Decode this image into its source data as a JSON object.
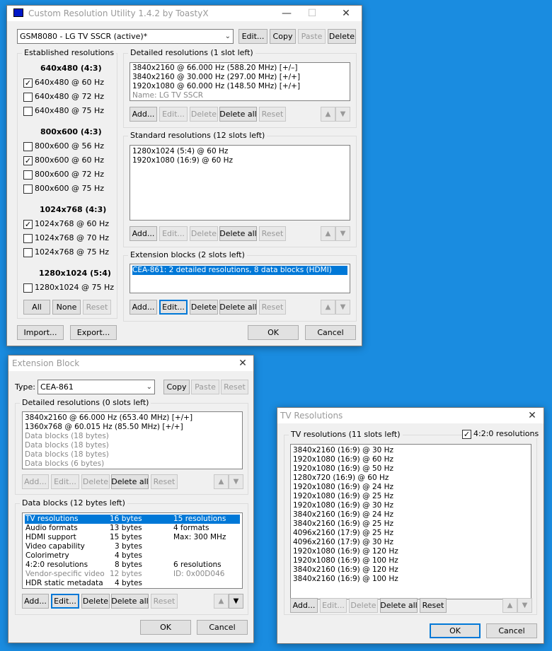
{
  "main": {
    "title": "Custom Resolution Utility 1.4.2 by ToastyX",
    "monitor": "GSM8080 - LG TV SSCR (active)*",
    "top_buttons": {
      "edit": "Edit...",
      "copy": "Copy",
      "paste": "Paste",
      "delete": "Delete"
    },
    "established": {
      "label": "Established resolutions",
      "groups": [
        {
          "header": "640x480 (4:3)",
          "items": [
            {
              "label": "640x480 @ 60 Hz",
              "checked": true
            },
            {
              "label": "640x480 @ 72 Hz",
              "checked": false
            },
            {
              "label": "640x480 @ 75 Hz",
              "checked": false
            }
          ]
        },
        {
          "header": "800x600 (4:3)",
          "items": [
            {
              "label": "800x600 @ 56 Hz",
              "checked": false
            },
            {
              "label": "800x600 @ 60 Hz",
              "checked": true
            },
            {
              "label": "800x600 @ 72 Hz",
              "checked": false
            },
            {
              "label": "800x600 @ 75 Hz",
              "checked": false
            }
          ]
        },
        {
          "header": "1024x768 (4:3)",
          "items": [
            {
              "label": "1024x768 @ 60 Hz",
              "checked": true
            },
            {
              "label": "1024x768 @ 70 Hz",
              "checked": false
            },
            {
              "label": "1024x768 @ 75 Hz",
              "checked": false
            }
          ]
        },
        {
          "header": "1280x1024 (5:4)",
          "items": [
            {
              "label": "1280x1024 @ 75 Hz",
              "checked": false
            }
          ]
        }
      ],
      "buttons": {
        "all": "All",
        "none": "None",
        "reset": "Reset"
      }
    },
    "detailed": {
      "label": "Detailed resolutions (1 slot left)",
      "items": [
        "3840x2160 @ 66.000 Hz (588.20 MHz) [+/–]",
        "3840x2160 @ 30.000 Hz (297.00 MHz) [+/+]",
        "1920x1080 @ 60.000 Hz (148.50 MHz) [+/+]",
        "Name: LG TV SSCR"
      ]
    },
    "standard": {
      "label": "Standard resolutions (12 slots left)",
      "items": [
        "1280x1024 (5:4) @ 60 Hz",
        "1920x1080 (16:9) @ 60 Hz"
      ]
    },
    "extension": {
      "label": "Extension blocks (2 slots left)",
      "items": [
        "CEA-861: 2 detailed resolutions, 8 data blocks (HDMI)"
      ]
    },
    "row_buttons": {
      "add": "Add...",
      "edit": "Edit...",
      "delete": "Delete",
      "delete_all": "Delete all",
      "reset": "Reset"
    },
    "bottom": {
      "import": "Import...",
      "export": "Export...",
      "ok": "OK",
      "cancel": "Cancel"
    }
  },
  "ext": {
    "title": "Extension Block",
    "type_label": "Type:",
    "type_value": "CEA-861",
    "top_buttons": {
      "copy": "Copy",
      "paste": "Paste",
      "reset": "Reset"
    },
    "detailed": {
      "label": "Detailed resolutions (0 slots left)",
      "items": [
        "3840x2160 @ 66.000 Hz (653.40 MHz) [+/+]",
        "1360x768 @ 60.015 Hz (85.50 MHz) [+/+]",
        "Data blocks (18 bytes)",
        "Data blocks (18 bytes)",
        "Data blocks (18 bytes)",
        "Data blocks (6 bytes)"
      ]
    },
    "blocks": {
      "label": "Data blocks (12 bytes left)",
      "rows": [
        {
          "name": "TV resolutions",
          "size": "16 bytes",
          "info": "15 resolutions"
        },
        {
          "name": "Audio formats",
          "size": "13 bytes",
          "info": "4 formats"
        },
        {
          "name": "HDMI support",
          "size": "15 bytes",
          "info": "Max: 300 MHz"
        },
        {
          "name": "Video capability",
          "size": "3 bytes",
          "info": ""
        },
        {
          "name": "Colorimetry",
          "size": "4 bytes",
          "info": ""
        },
        {
          "name": "4:2:0 resolutions",
          "size": "8 bytes",
          "info": "6 resolutions"
        },
        {
          "name": "Vendor-specific video",
          "size": "12 bytes",
          "info": "ID: 0x00D046"
        },
        {
          "name": "HDR static metadata",
          "size": "4 bytes",
          "info": ""
        }
      ]
    },
    "row_buttons": {
      "add": "Add...",
      "edit": "Edit...",
      "delete": "Delete",
      "delete_all": "Delete all",
      "reset": "Reset"
    },
    "bottom": {
      "ok": "OK",
      "cancel": "Cancel"
    }
  },
  "tv": {
    "title": "TV Resolutions",
    "label": "TV resolutions (11 slots left)",
    "check_label": "4:2:0 resolutions",
    "items": [
      "3840x2160 (16:9) @ 30 Hz",
      "1920x1080 (16:9) @ 60 Hz",
      "1920x1080 (16:9) @ 50 Hz",
      "1280x720 (16:9) @ 60 Hz",
      "1920x1080 (16:9) @ 24 Hz",
      "1920x1080 (16:9) @ 25 Hz",
      "1920x1080 (16:9) @ 30 Hz",
      "3840x2160 (16:9) @ 24 Hz",
      "3840x2160 (16:9) @ 25 Hz",
      "4096x2160 (17:9) @ 25 Hz",
      "4096x2160 (17:9) @ 30 Hz",
      "1920x1080 (16:9) @ 120 Hz",
      "1920x1080 (16:9) @ 100 Hz",
      "3840x2160 (16:9) @ 120 Hz",
      "3840x2160 (16:9) @ 100 Hz"
    ],
    "row_buttons": {
      "add": "Add...",
      "edit": "Edit...",
      "delete": "Delete",
      "delete_all": "Delete all",
      "reset": "Reset"
    },
    "bottom": {
      "ok": "OK",
      "cancel": "Cancel"
    }
  }
}
